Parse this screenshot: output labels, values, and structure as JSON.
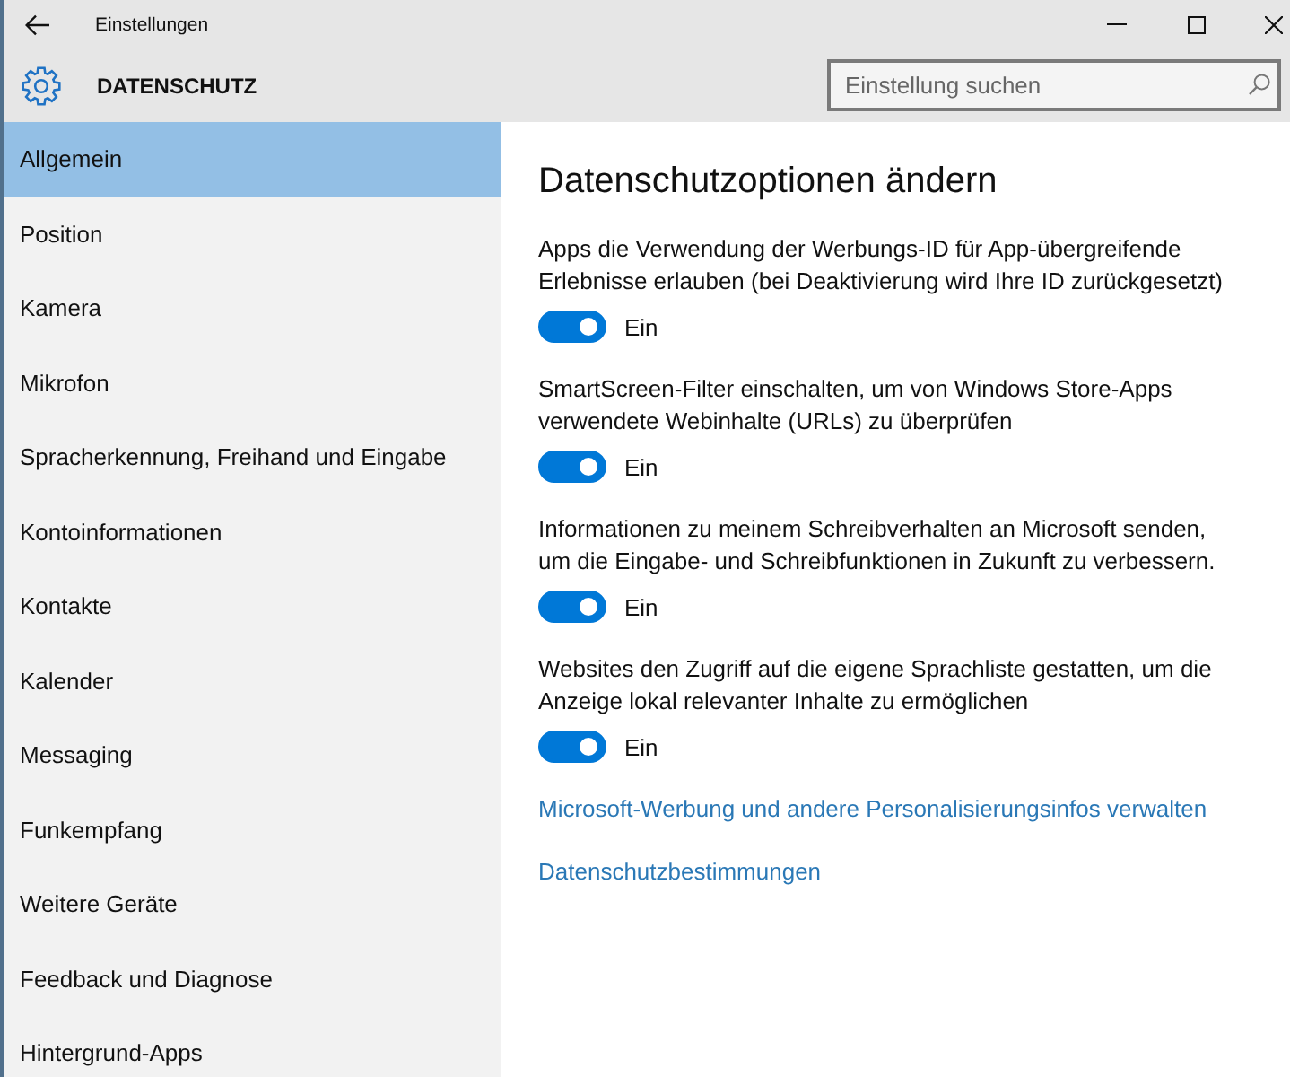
{
  "window": {
    "title": "Einstellungen"
  },
  "header": {
    "title": "DATENSCHUTZ",
    "search": {
      "placeholder": "Einstellung suchen"
    }
  },
  "sidebar": {
    "items": [
      {
        "label": "Allgemein",
        "selected": true
      },
      {
        "label": "Position",
        "selected": false
      },
      {
        "label": "Kamera",
        "selected": false
      },
      {
        "label": "Mikrofon",
        "selected": false
      },
      {
        "label": "Spracherkennung, Freihand und Eingabe",
        "selected": false
      },
      {
        "label": "Kontoinformationen",
        "selected": false
      },
      {
        "label": "Kontakte",
        "selected": false
      },
      {
        "label": "Kalender",
        "selected": false
      },
      {
        "label": "Messaging",
        "selected": false
      },
      {
        "label": "Funkempfang",
        "selected": false
      },
      {
        "label": "Weitere Geräte",
        "selected": false
      },
      {
        "label": "Feedback und Diagnose",
        "selected": false
      },
      {
        "label": "Hintergrund-Apps",
        "selected": false
      }
    ]
  },
  "content": {
    "heading": "Datenschutzoptionen ändern",
    "settings": [
      {
        "description": "Apps die Verwendung der Werbungs-ID für App-übergreifende Erlebnisse erlauben (bei Deaktivierung wird Ihre ID zurückgesetzt)",
        "on": true,
        "state_label": "Ein"
      },
      {
        "description": "SmartScreen-Filter einschalten, um von Windows Store-Apps verwendete Webinhalte (URLs) zu überprüfen",
        "on": true,
        "state_label": "Ein"
      },
      {
        "description": "Informationen zu meinem Schreibverhalten an Microsoft senden, um die Eingabe- und Schreibfunktionen in Zukunft zu verbessern.",
        "on": true,
        "state_label": "Ein"
      },
      {
        "description": "Websites den Zugriff auf die eigene Sprachliste gestatten, um die Anzeige lokal relevanter Inhalte zu ermöglichen",
        "on": true,
        "state_label": "Ein"
      }
    ],
    "links": [
      {
        "label": "Microsoft-Werbung und andere Personalisierungsinfos verwalten"
      },
      {
        "label": "Datenschutzbestimmungen"
      }
    ]
  }
}
